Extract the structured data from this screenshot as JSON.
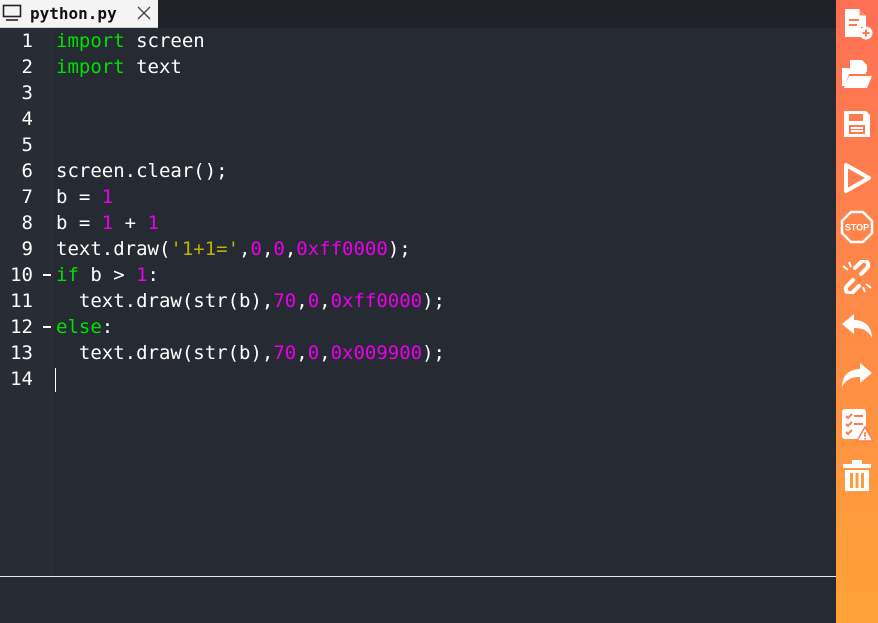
{
  "tab": {
    "title": "python.py",
    "icon": "monitor-icon",
    "close_icon": "close-icon"
  },
  "editor": {
    "lines": [
      {
        "n": "1",
        "tokens": [
          {
            "t": "import",
            "c": "kw"
          },
          {
            "t": " screen",
            "c": ""
          }
        ]
      },
      {
        "n": "2",
        "tokens": [
          {
            "t": "import",
            "c": "kw"
          },
          {
            "t": " text",
            "c": ""
          }
        ]
      },
      {
        "n": "3",
        "tokens": []
      },
      {
        "n": "4",
        "tokens": []
      },
      {
        "n": "5",
        "tokens": []
      },
      {
        "n": "6",
        "tokens": [
          {
            "t": "screen.clear();",
            "c": ""
          }
        ]
      },
      {
        "n": "7",
        "tokens": [
          {
            "t": "b = ",
            "c": ""
          },
          {
            "t": "1",
            "c": "num"
          }
        ]
      },
      {
        "n": "8",
        "tokens": [
          {
            "t": "b = ",
            "c": ""
          },
          {
            "t": "1",
            "c": "num"
          },
          {
            "t": " + ",
            "c": ""
          },
          {
            "t": "1",
            "c": "num"
          }
        ]
      },
      {
        "n": "9",
        "tokens": [
          {
            "t": "text.draw(",
            "c": ""
          },
          {
            "t": "'1+1='",
            "c": "str"
          },
          {
            "t": ",",
            "c": ""
          },
          {
            "t": "0",
            "c": "num"
          },
          {
            "t": ",",
            "c": ""
          },
          {
            "t": "0",
            "c": "num"
          },
          {
            "t": ",",
            "c": ""
          },
          {
            "t": "0xff0000",
            "c": "num"
          },
          {
            "t": ");",
            "c": ""
          }
        ]
      },
      {
        "n": "10",
        "fold": true,
        "tokens": [
          {
            "t": "if",
            "c": "kw"
          },
          {
            "t": " b > ",
            "c": ""
          },
          {
            "t": "1",
            "c": "num"
          },
          {
            "t": ":",
            "c": ""
          }
        ]
      },
      {
        "n": "11",
        "tokens": [
          {
            "t": "  text.draw(str(b),",
            "c": ""
          },
          {
            "t": "70",
            "c": "num"
          },
          {
            "t": ",",
            "c": ""
          },
          {
            "t": "0",
            "c": "num"
          },
          {
            "t": ",",
            "c": ""
          },
          {
            "t": "0xff0000",
            "c": "num"
          },
          {
            "t": ");",
            "c": ""
          }
        ]
      },
      {
        "n": "12",
        "fold": true,
        "tokens": [
          {
            "t": "else",
            "c": "kw"
          },
          {
            "t": ":",
            "c": ""
          }
        ]
      },
      {
        "n": "13",
        "tokens": [
          {
            "t": "  text.draw(str(b),",
            "c": ""
          },
          {
            "t": "70",
            "c": "num"
          },
          {
            "t": ",",
            "c": ""
          },
          {
            "t": "0",
            "c": "num"
          },
          {
            "t": ",",
            "c": ""
          },
          {
            "t": "0x009900",
            "c": "num"
          },
          {
            "t": ");",
            "c": ""
          }
        ]
      },
      {
        "n": "14",
        "tokens": []
      }
    ]
  },
  "toolbar": {
    "tools": [
      {
        "name": "new-file",
        "icon": "new-file-icon"
      },
      {
        "name": "open-folder",
        "icon": "folder-open-icon"
      },
      {
        "name": "save",
        "icon": "save-icon"
      },
      {
        "name": "run",
        "icon": "play-icon"
      },
      {
        "name": "stop",
        "icon": "stop-icon",
        "label": "STOP"
      },
      {
        "name": "connect",
        "icon": "link-icon"
      },
      {
        "name": "undo",
        "icon": "undo-icon"
      },
      {
        "name": "redo",
        "icon": "redo-icon"
      },
      {
        "name": "check",
        "icon": "checklist-warning-icon"
      },
      {
        "name": "delete",
        "icon": "trash-icon"
      }
    ]
  },
  "colors": {
    "keyword": "#00e000",
    "number": "#e800e8",
    "string": "#b9b400",
    "sidebar_top": "#ff6f54",
    "sidebar_bottom": "#ffa238"
  }
}
